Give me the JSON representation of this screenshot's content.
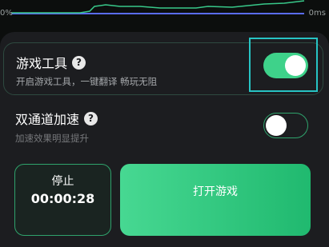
{
  "chart": {
    "left_label": "0%",
    "right_label": "0ms"
  },
  "game_tools": {
    "title": "游戏工具",
    "subtitle": "开启游戏工具，一键翻译 畅玩无阻",
    "toggle_on": true
  },
  "dual_channel": {
    "title": "双通道加速",
    "subtitle": "加速效果明显提升",
    "toggle_on": false
  },
  "stop_button": {
    "label": "停止",
    "timer": "00:00:28"
  },
  "open_game_button": {
    "label": "打开游戏"
  },
  "colors": {
    "accent_green": "#3ed28a",
    "focus_outline": "#27c4c4",
    "chart_blue": "#5a6cf5",
    "chart_green": "#38c98a"
  },
  "icons": {
    "help": "question-circle",
    "collapse": "chevron-up"
  }
}
